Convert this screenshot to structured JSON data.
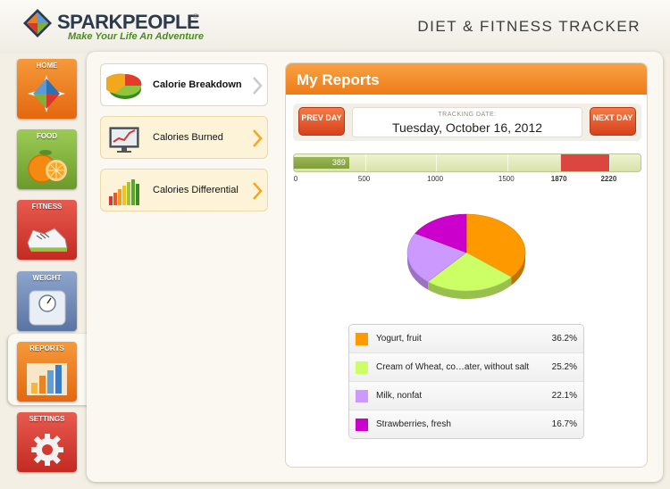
{
  "header": {
    "brand": "SPARKPEOPLE",
    "registered": "®",
    "tagline": "Make Your Life An Adventure",
    "app_title": "DIET & FITNESS TRACKER"
  },
  "nav": {
    "items": [
      {
        "label": "HOME",
        "color": "#f07b1d",
        "icon": "compass-icon"
      },
      {
        "label": "FOOD",
        "color": "#7fb03a",
        "icon": "orange-icon"
      },
      {
        "label": "FITNESS",
        "color": "#d9362e",
        "icon": "sneaker-icon"
      },
      {
        "label": "WEIGHT",
        "color": "#6f88b5",
        "icon": "scale-icon"
      },
      {
        "label": "REPORTS",
        "color": "#f07b1d",
        "icon": "bar-chart-icon",
        "selected": true
      },
      {
        "label": "SETTINGS",
        "color": "#d9362e",
        "icon": "gear-icon"
      }
    ]
  },
  "report_list": {
    "items": [
      {
        "label": "Calorie Breakdown",
        "selected": true,
        "icon": "pie-chart-icon"
      },
      {
        "label": "Calories Burned",
        "selected": false,
        "icon": "monitor-chart-icon"
      },
      {
        "label": "Calories Differential",
        "selected": false,
        "icon": "bar-chart-icon"
      }
    ]
  },
  "reports": {
    "title": "My Reports",
    "prev_day": "PREV DAY",
    "next_day": "NEXT DAY",
    "tracking_caption": "TRACKING DATE:",
    "tracking_date": "Tuesday, October 16, 2012"
  },
  "calorie_range": {
    "consumed": 389,
    "consumed_label": "389",
    "max": 2450,
    "target_low": 1870,
    "target_high": 2220,
    "ticks": [
      "0",
      "500",
      "1000",
      "1500",
      "1870",
      "2220"
    ],
    "colors": {
      "consumed": "#7f9f36",
      "target": "#dc4540"
    }
  },
  "breakdown": {
    "items": [
      {
        "name": "Yogurt, fruit",
        "pct": "36.2%",
        "value": 36.2,
        "color": "#ff9900"
      },
      {
        "name": "Cream of Wheat, co…ater, without salt",
        "pct": "25.2%",
        "value": 25.2,
        "color": "#ccff66"
      },
      {
        "name": "Milk, nonfat",
        "pct": "22.1%",
        "value": 22.1,
        "color": "#cc99ff"
      },
      {
        "name": "Strawberries, fresh",
        "pct": "16.7%",
        "value": 16.7,
        "color": "#cc00cc"
      }
    ]
  }
}
